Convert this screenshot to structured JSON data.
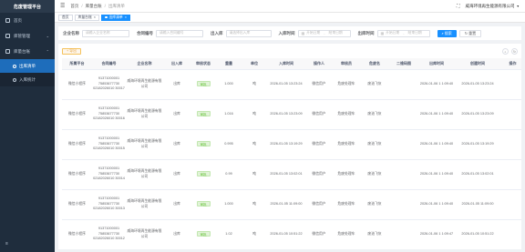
{
  "app": {
    "title": "危废管理平台"
  },
  "sidebar": {
    "items": [
      {
        "label": "首页",
        "icon": "home-icon"
      },
      {
        "label": "库管管理",
        "icon": "database-icon"
      },
      {
        "label": "库量台账",
        "icon": "ledger-icon"
      }
    ],
    "submenu": [
      {
        "label": "出库清单",
        "active": true
      },
      {
        "label": "入库统计",
        "active": false
      }
    ],
    "collapse_icon": "≡"
  },
  "header": {
    "breadcrumb": [
      "首页",
      "库量台账",
      "出库清单"
    ],
    "company": "威海环境再生能源有限公司"
  },
  "tags": [
    {
      "label": "首页",
      "active": false
    },
    {
      "label": "库量台账",
      "active": false
    },
    {
      "label": "出库清单",
      "active": true
    }
  ],
  "search": {
    "company_label": "企业名称",
    "company_placeholder": "请输入企业名称",
    "contract_label": "合同编号",
    "contract_placeholder": "请输入合同编号",
    "io_label": "出入库",
    "io_placeholder": "请选择出入库",
    "in_time_label": "入库时间",
    "out_time_label": "出库时间",
    "start_placeholder": "开始日期",
    "end_placeholder": "结束日期",
    "date_sep": "-",
    "search_btn": "搜索",
    "reset_btn": "重置"
  },
  "toolbar": {
    "add_label": "+ 导出"
  },
  "table": {
    "columns": [
      "所属平台",
      "合同编号",
      "企业名称",
      "出入库",
      "审核状态",
      "重量",
      "单位",
      "入库时间",
      "操作人",
      "审核员",
      "危废名",
      "二维码图",
      "出库时间",
      "创建时间",
      "操作"
    ],
    "rows": [
      {
        "platform": "微信小程序",
        "contract": "91371000001 75853677730 02182026010 30017",
        "company": "威海环境再生能源有限公司",
        "io": "出库",
        "status": "审批",
        "weight": "1.000",
        "unit": "吨",
        "in_time": "2026-01-05 13:23:24",
        "op": "微信用户",
        "auditor": "危废处理车",
        "waste": "废油飞灰",
        "qr": "",
        "out_time": "2026-01-06 1 1:09:40",
        "created": "2026-01-05 13:23:24",
        "action": ""
      },
      {
        "platform": "微信小程序",
        "contract": "91371000001 75853677730 02182026010 30016",
        "company": "威海环境再生能源有限公司",
        "io": "出库",
        "status": "审批",
        "weight": "1.016",
        "unit": "吨",
        "in_time": "2026-01-05 13:23:09",
        "op": "微信用户",
        "auditor": "危废处理车",
        "waste": "废油飞灰",
        "qr": "",
        "out_time": "2026-01-06 1 1:09:40",
        "created": "2026-01-05 13:23:09",
        "action": ""
      },
      {
        "platform": "微信小程序",
        "contract": "91371000001 75853677730 02182026010 30015",
        "company": "威海环境再生能源有限公司",
        "io": "出库",
        "status": "审批",
        "weight": "0.995",
        "unit": "吨",
        "in_time": "2026-01-05 13:19:29",
        "op": "微信用户",
        "auditor": "危废处理车",
        "waste": "废油飞灰",
        "qr": "",
        "out_time": "2026-01-06 1 1:09:40",
        "created": "2026-01-05 13:19:29",
        "action": ""
      },
      {
        "platform": "微信小程序",
        "contract": "91371000001 75853677730 02182026010 30014",
        "company": "威海环境再生能源有限公司",
        "io": "出库",
        "status": "审批",
        "weight": "0.99",
        "unit": "吨",
        "in_time": "2026-01-05 13:02:01",
        "op": "微信用户",
        "auditor": "危废处理车",
        "waste": "废油飞灰",
        "qr": "",
        "out_time": "2026-01-06 1 1:09:40",
        "created": "2026-01-05 13:02:01",
        "action": ""
      },
      {
        "platform": "微信小程序",
        "contract": "91371000001 75853677730 02182026010 30013",
        "company": "威海环境再生能源有限公司",
        "io": "出库",
        "status": "审批",
        "weight": "1.000",
        "unit": "吨",
        "in_time": "2026-01-05 11:09:00",
        "op": "微信用户",
        "auditor": "危废处理车",
        "waste": "废油飞灰",
        "qr": "",
        "out_time": "2026-01-06 1 1:09:40",
        "created": "2026-01-05 11:09:00",
        "action": ""
      },
      {
        "platform": "微信小程序",
        "contract": "91371000001 75853677730 02182026010 30012",
        "company": "威海环境再生能源有限公司",
        "io": "出库",
        "status": "审批",
        "weight": "1.02",
        "unit": "吨",
        "in_time": "2026-01-05 10:51:22",
        "op": "微信用户",
        "auditor": "危废处理车",
        "waste": "废油飞灰",
        "qr": "",
        "out_time": "2026-01-06 1 1:09:47",
        "created": "2026-01-05 10:51:22",
        "action": ""
      }
    ]
  },
  "colors": {
    "sidebar_bg": "#1f2d3d",
    "primary": "#1890ff",
    "success": "#67c23a"
  }
}
